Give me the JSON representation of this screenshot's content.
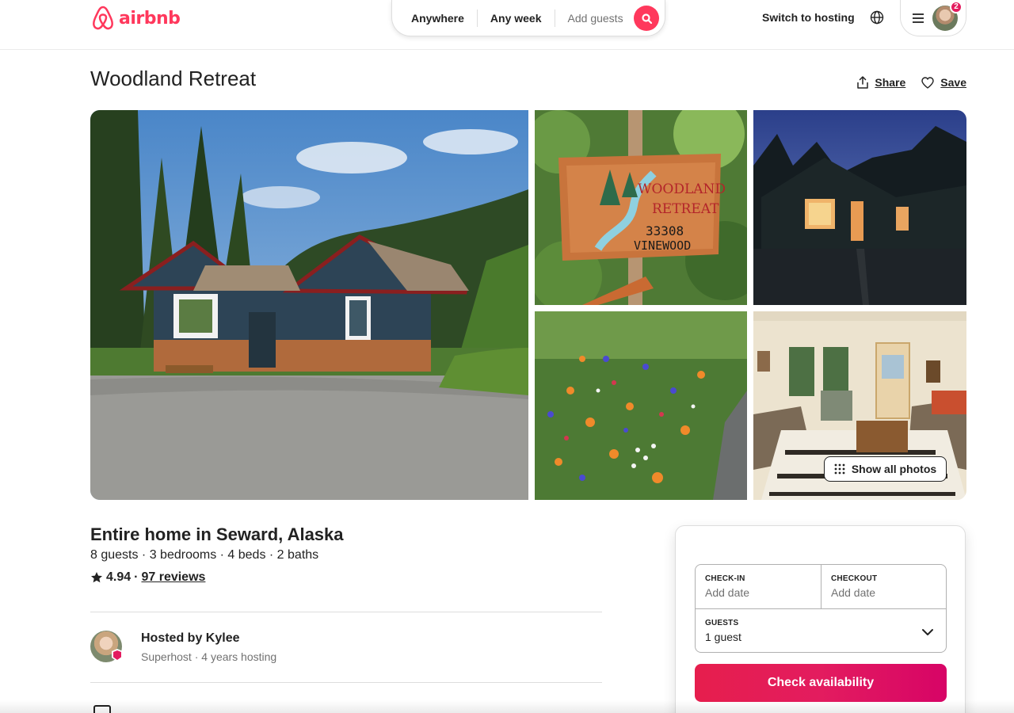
{
  "header": {
    "logo_text": "airbnb",
    "search": {
      "where": "Anywhere",
      "when": "Any week",
      "who": "Add guests"
    },
    "switch_to_hosting": "Switch to hosting",
    "notification_count": "2",
    "brand_color": "#FF385C"
  },
  "listing": {
    "title": "Woodland Retreat",
    "share_label": "Share",
    "save_label": "Save",
    "show_all_photos": "Show all photos",
    "subtitle": "Entire home in Seward, Alaska",
    "details": "8 guests · 3 bedrooms · 4 beds · 2 baths",
    "rating": "4.94",
    "rating_separator": "·",
    "reviews": "97 reviews"
  },
  "host": {
    "hosted_by": "Hosted by Kylee",
    "meta": "Superhost · 4 years hosting"
  },
  "booking": {
    "checkin_label": "CHECK-IN",
    "checkin_value": "Add date",
    "checkout_label": "CHECKOUT",
    "checkout_value": "Add date",
    "guests_label": "GUESTS",
    "guests_value": "1 guest",
    "cta": "Check availability"
  },
  "icons": {
    "logo": "airbnb-logo-icon",
    "search": "search-icon",
    "globe": "globe-icon",
    "menu": "hamburger-menu-icon",
    "share": "share-icon",
    "save": "heart-icon",
    "grid": "grid-dots-icon",
    "star": "star-icon",
    "chevron": "chevron-down-icon"
  }
}
